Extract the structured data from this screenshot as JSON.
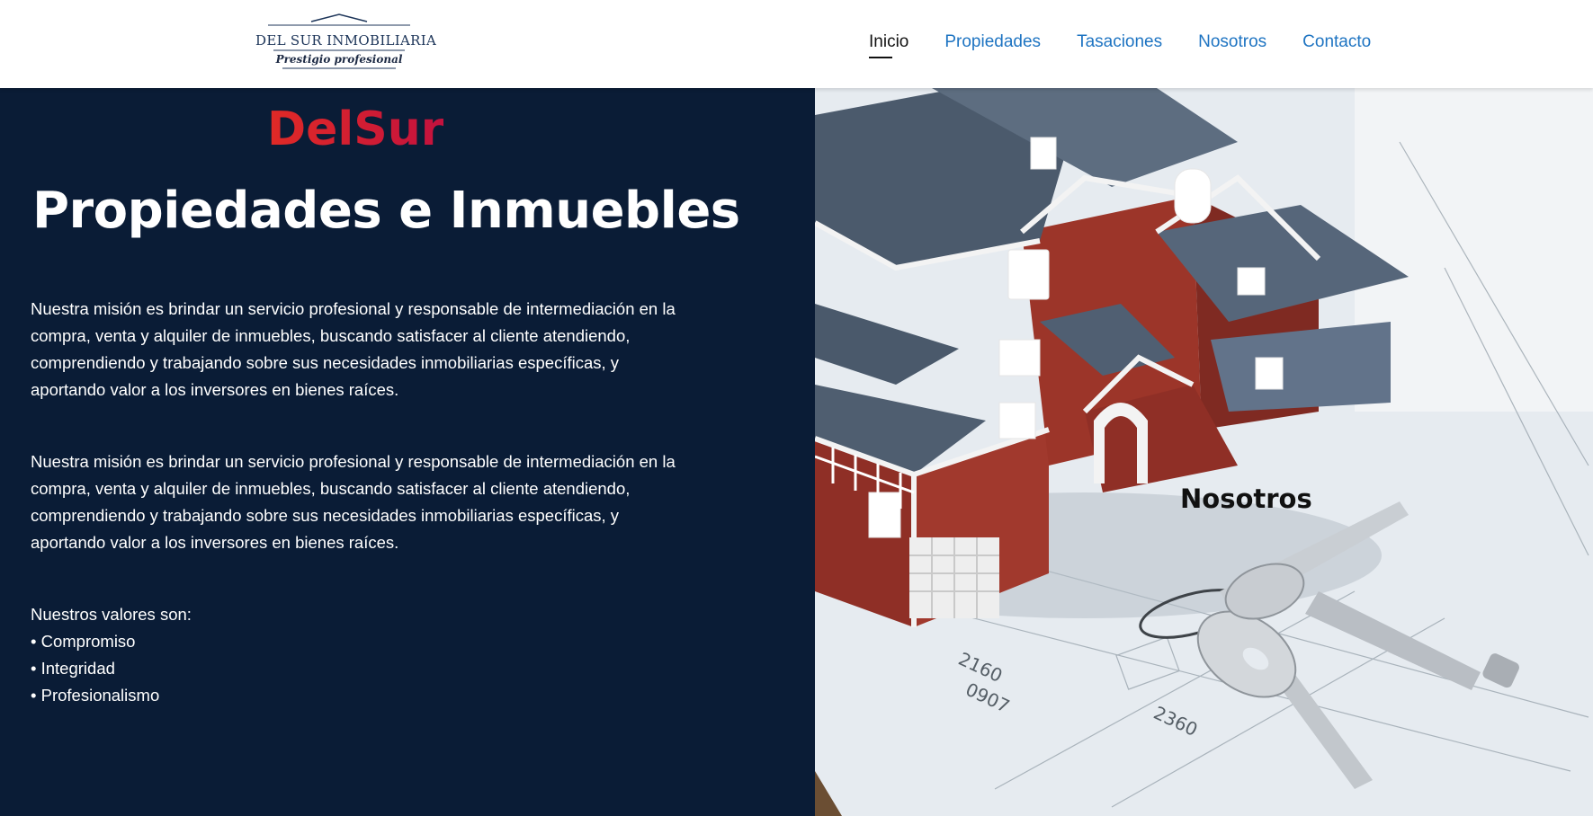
{
  "header": {
    "logo": {
      "name": "DEL SUR INMOBILIARIA",
      "tagline": "Prestigio profesional"
    },
    "nav": [
      {
        "label": "Inicio",
        "active": true
      },
      {
        "label": "Propiedades",
        "active": false
      },
      {
        "label": "Tasaciones",
        "active": false
      },
      {
        "label": "Nosotros",
        "active": false
      },
      {
        "label": "Contacto",
        "active": false
      }
    ]
  },
  "hero": {
    "brand": "DelSur",
    "title": "Propiedades e Inmuebles",
    "paragraph_1": "Nuestra misión es brindar un servicio profesional y responsable de intermediación en la compra, venta y alquiler de inmuebles, buscando satisfacer al cliente atendiendo, comprendiendo y trabajando sobre sus necesidades inmobiliarias específicas, y aportando valor a los inversores en bienes raíces.",
    "paragraph_2": "Nuestra misión es brindar un servicio profesional y responsable de intermediación en la compra, venta y alquiler de inmuebles, buscando satisfacer al cliente atendiendo, comprendiendo y trabajando sobre sus necesidades inmobiliarias específicas, y aportando valor a los inversores en bienes raíces.",
    "values_heading": "Nuestros valores son:",
    "values": [
      "• Compromiso",
      "• Integridad",
      "• Profesionalismo"
    ]
  },
  "image_panel": {
    "overlay_label": "Nosotros",
    "plan_numbers": [
      "2160",
      "0907",
      "2360"
    ]
  },
  "colors": {
    "header_bg": "#ffffff",
    "nav_link": "#1e74c2",
    "nav_active": "#111111",
    "panel_bg": "#0a1c36",
    "brand_gradient_start": "#e02a26",
    "brand_gradient_end": "#c4123e"
  }
}
